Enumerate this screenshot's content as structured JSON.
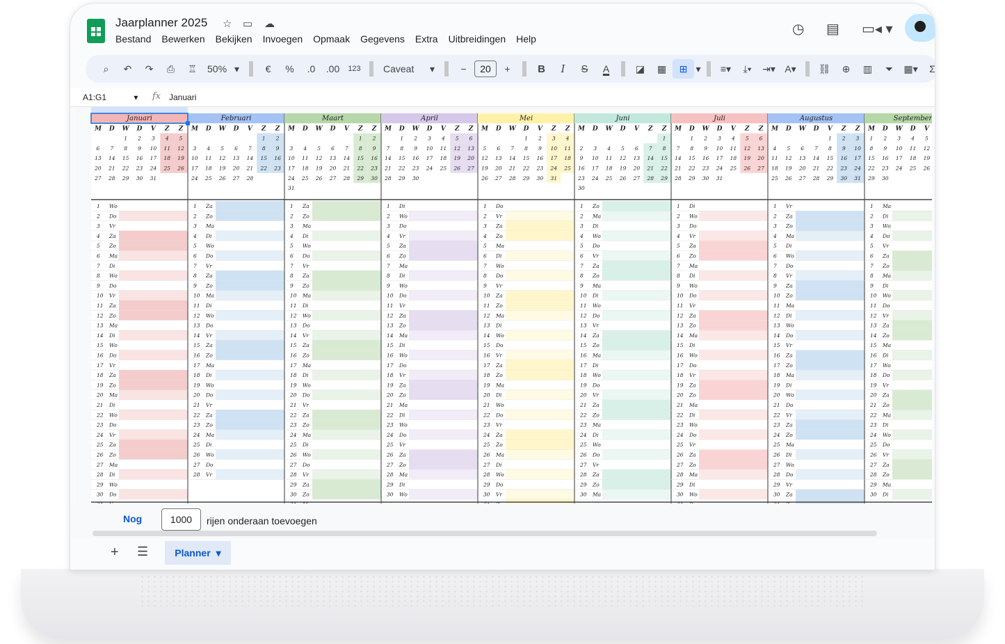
{
  "doc": {
    "title": "Jaarplanner 2025",
    "menus": [
      "Bestand",
      "Bewerken",
      "Bekijken",
      "Invoegen",
      "Opmaak",
      "Gegevens",
      "Extra",
      "Uitbreidingen",
      "Help"
    ]
  },
  "toolbar": {
    "zoom": "50%",
    "currency": "€",
    "percent": "%",
    "dec_decrease": ".0",
    "dec_increase": ".00",
    "number_format": "123",
    "font": "Caveat",
    "minus": "−",
    "font_size": "20",
    "plus": "+",
    "bold": "B",
    "italic": "I",
    "strike": "S",
    "text_color": "A",
    "text_rotate": "A",
    "sum": "Σ"
  },
  "formula_bar": {
    "cell_ref": "A1:G1",
    "fx": "fx",
    "value": "Januari"
  },
  "grid": {
    "weekday_labels": [
      "M",
      "D",
      "W",
      "D",
      "V",
      "Z",
      "Z"
    ],
    "day_abbrev": [
      "Ma",
      "Di",
      "Wo",
      "Do",
      "Vr",
      "Za",
      "Zo"
    ],
    "year": 2025,
    "months": [
      {
        "name": "Januari",
        "color": "#f4cccc",
        "header_color": "#f4b5b5"
      },
      {
        "name": "Februari",
        "color": "#cfe2f3",
        "header_color": "#a4c2f4"
      },
      {
        "name": "Maart",
        "color": "#d9ead3",
        "header_color": "#b6d7a8"
      },
      {
        "name": "April",
        "color": "#e6ddf0",
        "header_color": "#d5c8ea"
      },
      {
        "name": "Mei",
        "color": "#fff6cc",
        "header_color": "#fff2a8"
      },
      {
        "name": "Juni",
        "color": "#d9f0e8",
        "header_color": "#c2e8dc"
      },
      {
        "name": "Juli",
        "color": "#fad4d4",
        "header_color": "#f7c1c1"
      },
      {
        "name": "Augustus",
        "color": "#cfe2f3",
        "header_color": "#a4c2f4"
      },
      {
        "name": "September",
        "color": "#d9ead3",
        "header_color": "#b6d7a8"
      }
    ],
    "weekend_color": "#f4d4d4"
  },
  "footer": {
    "add_link": "Nog",
    "rows_value": "1000",
    "rows_label": "rijen onderaan toevoegen"
  },
  "tabs": {
    "active": "Planner"
  }
}
